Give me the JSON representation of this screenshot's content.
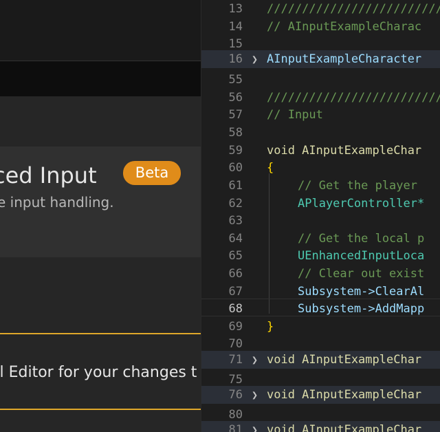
{
  "plugin_panel": {
    "card_title": "ced Input",
    "badge": "Beta",
    "card_description": "e input handling.",
    "restart_notice": "al Editor for your changes t"
  },
  "editor": {
    "lines": [
      {
        "num": "13",
        "code": "/////////////////////////////",
        "fold": false
      },
      {
        "num": "14",
        "code": "// AInputExampleCharac",
        "fold": false
      },
      {
        "num": "15",
        "code": "",
        "fold": false
      },
      {
        "num": "16",
        "code": "AInputExampleCharacter",
        "fold": true
      },
      {
        "num": "55",
        "code": "",
        "fold": false
      },
      {
        "num": "56",
        "code": "/////////////////////////////",
        "fold": false
      },
      {
        "num": "57",
        "code": "// Input",
        "fold": false
      },
      {
        "num": "58",
        "code": "",
        "fold": false
      },
      {
        "num": "59",
        "code": "void AInputExampleChar",
        "fold": false
      },
      {
        "num": "60",
        "code": "{",
        "fold": false
      },
      {
        "num": "61",
        "code": "// Get the player",
        "fold": false
      },
      {
        "num": "62",
        "code": "APlayerController*",
        "fold": false
      },
      {
        "num": "63",
        "code": "",
        "fold": false
      },
      {
        "num": "64",
        "code": "// Get the local p",
        "fold": false
      },
      {
        "num": "65",
        "code": "UEnhancedInputLoca",
        "fold": false
      },
      {
        "num": "66",
        "code": "// Clear out exist",
        "fold": false
      },
      {
        "num": "67",
        "code": "Subsystem->ClearAl",
        "fold": false
      },
      {
        "num": "68",
        "code": "Subsystem->AddMapp",
        "fold": false
      },
      {
        "num": "69",
        "code": "}",
        "fold": false
      },
      {
        "num": "70",
        "code": "",
        "fold": false
      },
      {
        "num": "71",
        "code": "void AInputExampleChar",
        "fold": true
      },
      {
        "num": "75",
        "code": "",
        "fold": false
      },
      {
        "num": "76",
        "code": "void AInputExampleChar",
        "fold": true
      },
      {
        "num": "80",
        "code": "",
        "fold": false
      },
      {
        "num": "81",
        "code": "void AInputExampleChar",
        "fold": true
      }
    ],
    "active_line": "68",
    "colors": {
      "comment": "#6a9955",
      "keyword": "#569cd6",
      "function": "#dcdcaa",
      "variable": "#9cdcfe",
      "type": "#4ec9b0",
      "brace": "#ffd700",
      "badge": "#e08c1a",
      "notice_border": "#e0a82a"
    }
  }
}
